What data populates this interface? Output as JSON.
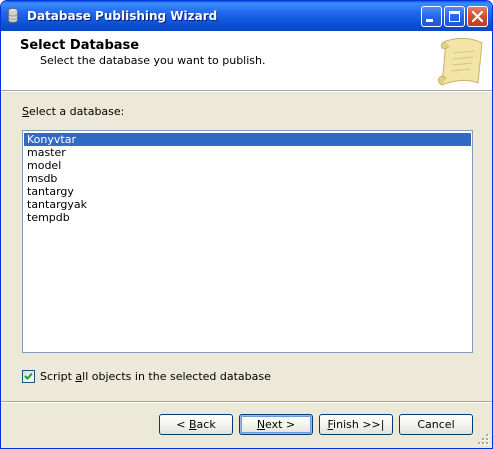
{
  "window": {
    "title": "Database Publishing Wizard"
  },
  "header": {
    "title": "Select Database",
    "subtitle": "Select the database you want to publish."
  },
  "main": {
    "select_label_mnemonic": "S",
    "select_label_rest": "elect a database:",
    "databases": [
      "Konyvtar",
      "master",
      "model",
      "msdb",
      "tantargy",
      "tantargyak",
      "tempdb"
    ],
    "selected_database": "Konyvtar",
    "script_all": {
      "checked": true,
      "label_pre": "Script ",
      "label_mnemonic": "a",
      "label_post": "ll objects in the selected database"
    }
  },
  "buttons": {
    "back_pre": "< ",
    "back_mnemonic": "B",
    "back_post": "ack",
    "next_mnemonic": "N",
    "next_post": "ext >",
    "finish_mnemonic": "F",
    "finish_post": "inish >>|",
    "cancel": "Cancel"
  },
  "colors": {
    "selection": "#316ac5",
    "titlebar": "#0a4fd6",
    "dialog_bg": "#ece9d8"
  }
}
